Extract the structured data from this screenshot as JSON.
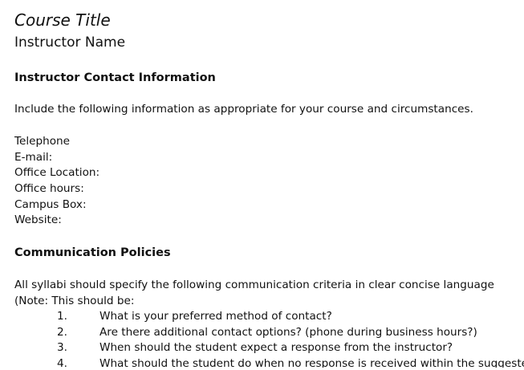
{
  "document": {
    "course_title": "Course Title",
    "instructor_name": "Instructor Name",
    "contact_section": {
      "heading": "Instructor Contact Information",
      "intro": "Include the following information as appropriate for your course and circumstances.",
      "fields": [
        "Telephone",
        "E-mail:",
        "Office Location:",
        "Office hours:",
        "Campus Box:",
        "Website:"
      ]
    },
    "communication_section": {
      "heading": "Communication Policies",
      "intro": "All syllabi should specify the following communication criteria in clear concise language",
      "note": "(Note:  This should be:",
      "items": [
        {
          "number": "1.",
          "text": "What is your preferred method of contact?"
        },
        {
          "number": "2.",
          "text": "Are there additional contact options? (phone during business hours?)"
        },
        {
          "number": "3.",
          "text": "When should the student expect a response from the instructor?"
        },
        {
          "number": "4.",
          "text": "What should the student do when no response is received within the suggested"
        }
      ]
    }
  }
}
